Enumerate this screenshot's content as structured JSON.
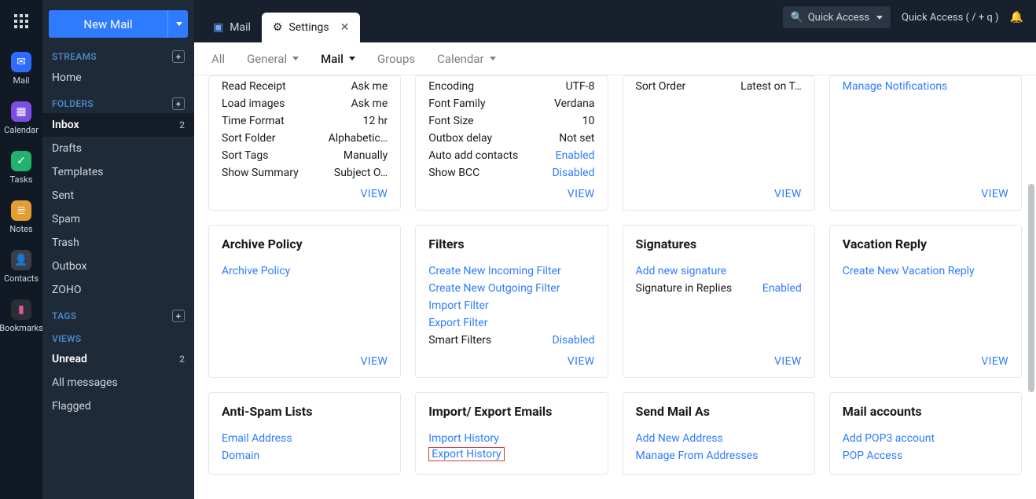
{
  "rail": {
    "mail": "Mail",
    "calendar": "Calendar",
    "tasks": "Tasks",
    "notes": "Notes",
    "contacts": "Contacts",
    "bookmarks": "Bookmarks"
  },
  "left": {
    "newmail": "New Mail",
    "h_streams": "STREAMS",
    "streams": {
      "home": "Home"
    },
    "h_folders": "FOLDERS",
    "folders": {
      "inbox": {
        "label": "Inbox",
        "count": "2"
      },
      "drafts": "Drafts",
      "templates": "Templates",
      "sent": "Sent",
      "spam": "Spam",
      "trash": "Trash",
      "outbox": "Outbox",
      "zoho": "ZOHO"
    },
    "h_tags": "TAGS",
    "h_views": "VIEWS",
    "views": {
      "unread": {
        "label": "Unread",
        "count": "2"
      },
      "all": "All messages",
      "flagged": "Flagged"
    }
  },
  "top": {
    "tab_mail": "Mail",
    "tab_settings": "Settings",
    "qa1": "Quick Access",
    "qa2": "Quick Access  ( / + q )"
  },
  "subtabs": {
    "all": "All",
    "general": "General",
    "mail": "Mail",
    "groups": "Groups",
    "calendar": "Calendar"
  },
  "viewtxt": "VIEW",
  "row1": {
    "c1": [
      {
        "k": "Read Receipt",
        "v": "Ask me"
      },
      {
        "k": "Load images",
        "v": "Ask me"
      },
      {
        "k": "Time Format",
        "v": "12 hr"
      },
      {
        "k": "Sort Folder",
        "v": "Alphabetic…"
      },
      {
        "k": "Sort Tags",
        "v": "Manually"
      },
      {
        "k": "Show Summary",
        "v": "Subject O…"
      }
    ],
    "c2": [
      {
        "k": "Encoding",
        "v": "UTF-8"
      },
      {
        "k": "Font Family",
        "v": "Verdana"
      },
      {
        "k": "Font Size",
        "v": "10"
      },
      {
        "k": "Outbox delay",
        "v": "Not set"
      },
      {
        "k": "Auto add contacts",
        "v": "Enabled",
        "link": true
      },
      {
        "k": "Show BCC",
        "v": "Disabled",
        "link": true
      }
    ],
    "c3": [
      {
        "k": "Sort Order",
        "v": "Latest on T…"
      }
    ],
    "c4_link": "Manage Notifications"
  },
  "row2": {
    "c1": {
      "title": "Archive Policy",
      "links": [
        "Archive Policy"
      ]
    },
    "c2": {
      "title": "Filters",
      "links": [
        "Create New Incoming Filter",
        "Create New Outgoing Filter",
        "Import Filter",
        "Export Filter"
      ],
      "kv": {
        "k": "Smart Filters",
        "v": "Disabled",
        "link": true
      }
    },
    "c3": {
      "title": "Signatures",
      "links": [
        "Add new signature"
      ],
      "kv": {
        "k": "Signature in Replies",
        "v": "Enabled",
        "link": true
      }
    },
    "c4": {
      "title": "Vacation Reply",
      "links": [
        "Create New Vacation Reply"
      ]
    }
  },
  "row3": {
    "c1": {
      "title": "Anti-Spam Lists",
      "links": [
        "Email Address",
        "Domain"
      ]
    },
    "c2": {
      "title": "Import/ Export Emails",
      "links": [
        "Import History",
        "Export History"
      ]
    },
    "c3": {
      "title": "Send Mail As",
      "links": [
        "Add New Address",
        "Manage From Addresses"
      ]
    },
    "c4": {
      "title": "Mail accounts",
      "links": [
        "Add POP3 account",
        "POP Access"
      ]
    }
  }
}
